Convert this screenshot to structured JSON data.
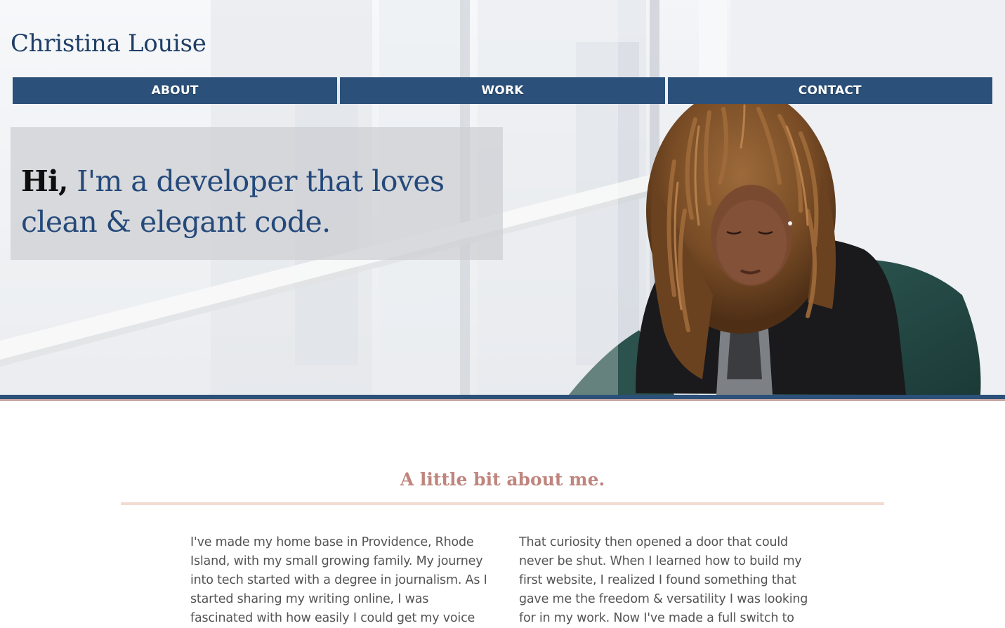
{
  "site": {
    "brand": "Christina Louise"
  },
  "nav": {
    "items": [
      {
        "label": "ABOUT"
      },
      {
        "label": "WORK"
      },
      {
        "label": "CONTACT"
      }
    ]
  },
  "hero": {
    "greeting": "Hi,",
    "tagline": " I'm a developer that loves clean & elegant code.",
    "image_alt_icon": "woman-portrait-photo"
  },
  "about": {
    "title": "A little bit about me.",
    "paragraphs": [
      "I've made my home base in Providence, Rhode Island, with my small growing family. My journey into tech started with a degree in journalism. As I started sharing my writing online, I was fascinated with how easily I could get my voice out there. I",
      "That curiosity then opened a door that could never be shut. When I learned how to build my first website, I realized I found something that gave me the freedom & versatility I was looking for in my work. Now I've made a full switch to"
    ]
  },
  "colors": {
    "brand_blue": "#1e3e66",
    "nav_blue": "#2b5079",
    "accent_pink": "#bf857e",
    "underline_pink": "#f4dbd2",
    "body_text": "#545454"
  }
}
